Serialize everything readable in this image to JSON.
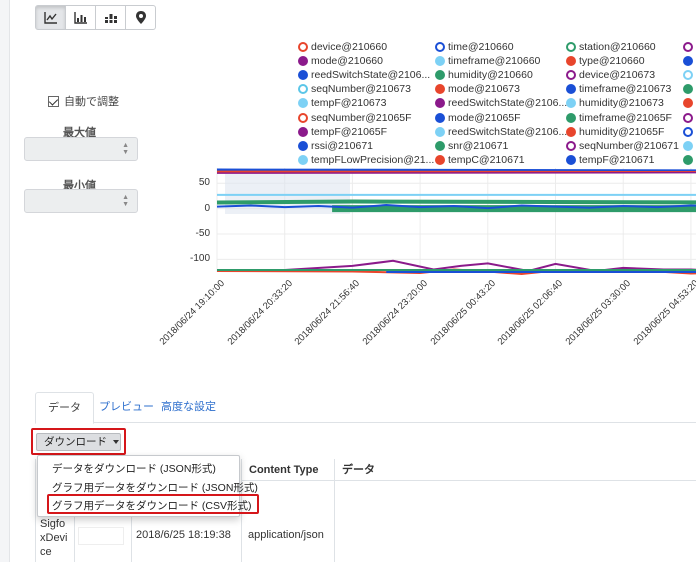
{
  "toolbar": {
    "buttons": [
      {
        "name": "line-chart-icon",
        "active": true
      },
      {
        "name": "bar-chart-icon",
        "active": false
      },
      {
        "name": "stacked-bar-icon",
        "active": false
      },
      {
        "name": "map-pin-icon",
        "active": false
      }
    ]
  },
  "controls": {
    "auto_adjust": "自動で調整",
    "auto_adjust_checked": true,
    "max_label": "最大値",
    "min_label": "最小値",
    "spin_up": "▲",
    "spin_down": "▼"
  },
  "legend": [
    [
      {
        "t": "device@210660",
        "c": "#e8452c",
        "o": true
      },
      {
        "t": "mode@210660",
        "c": "#8b1a8b",
        "o": false
      },
      {
        "t": "reedSwitchState@2106...",
        "c": "#1a4fd6",
        "o": false
      },
      {
        "t": "seqNumber@210673",
        "c": "#5bc6e8",
        "o": true
      },
      {
        "t": "tempF@210673",
        "c": "#7dd1f5",
        "o": false
      },
      {
        "t": "seqNumber@21065F",
        "c": "#e8452c",
        "o": true
      },
      {
        "t": "tempF@21065F",
        "c": "#8b1a8b",
        "o": false
      },
      {
        "t": "rssi@210671",
        "c": "#1a4fd6",
        "o": false
      },
      {
        "t": "tempFLowPrecision@21...",
        "c": "#7dd1f5",
        "o": false
      }
    ],
    [
      {
        "t": "time@210660",
        "c": "#1a4fd6",
        "o": true
      },
      {
        "t": "timeframe@210660",
        "c": "#7dd1f5",
        "o": false
      },
      {
        "t": "humidity@210660",
        "c": "#2e9b6a",
        "o": false
      },
      {
        "t": "mode@210673",
        "c": "#e8452c",
        "o": false
      },
      {
        "t": "reedSwitchState@2106...",
        "c": "#8b1a8b",
        "o": false
      },
      {
        "t": "mode@21065F",
        "c": "#1a4fd6",
        "o": false
      },
      {
        "t": "reedSwitchState@2106...",
        "c": "#7dd1f5",
        "o": false
      },
      {
        "t": "snr@210671",
        "c": "#2e9b6a",
        "o": false
      },
      {
        "t": "tempC@210671",
        "c": "#e8452c",
        "o": false
      }
    ],
    [
      {
        "t": "station@210660",
        "c": "#2e9b6a",
        "o": true
      },
      {
        "t": "type@210660",
        "c": "#e8452c",
        "o": false
      },
      {
        "t": "device@210673",
        "c": "#8b1a8b",
        "o": true
      },
      {
        "t": "timeframe@210673",
        "c": "#1a4fd6",
        "o": false
      },
      {
        "t": "humidity@210673",
        "c": "#7dd1f5",
        "o": false
      },
      {
        "t": "timeframe@21065F",
        "c": "#2e9b6a",
        "o": false
      },
      {
        "t": "humidity@21065F",
        "c": "#e8452c",
        "o": false
      },
      {
        "t": "seqNumber@210671",
        "c": "#8b1a8b",
        "o": true
      },
      {
        "t": "tempF@210671",
        "c": "#1a4fd6",
        "o": false
      }
    ],
    [
      {
        "t": "",
        "c": "#8b1a8b",
        "o": true
      },
      {
        "t": "",
        "c": "#1a4fd6",
        "o": false
      },
      {
        "t": "",
        "c": "#7dd1f5",
        "o": true
      },
      {
        "t": "",
        "c": "#2e9b6a",
        "o": false
      },
      {
        "t": "",
        "c": "#e8452c",
        "o": false
      },
      {
        "t": "",
        "c": "#8b1a8b",
        "o": true
      },
      {
        "t": "",
        "c": "#1a4fd6",
        "o": true
      },
      {
        "t": "",
        "c": "#7dd1f5",
        "o": false
      },
      {
        "t": "",
        "c": "#2e9b6a",
        "o": false
      }
    ]
  ],
  "chart_data": {
    "type": "line",
    "y_ticks": [
      "50",
      "0",
      "-50",
      "-100"
    ],
    "y_tick_values": [
      50,
      0,
      -50,
      -100
    ],
    "ylim": [
      -125,
      80
    ],
    "x_ticks": [
      "2018/06/24 19:10:00",
      "2018/06/24 20:33:20",
      "2018/06/24 21:56:40",
      "2018/06/24 23:20:00",
      "2018/06/25 00:43:20",
      "2018/06/25 02:06:40",
      "2018/06/25 03:30:00",
      "2018/06/25 04:53:20"
    ],
    "series": [
      {
        "color": "#2e9b6a",
        "width": 4,
        "x": [
          0,
          2,
          8
        ],
        "y": [
          12,
          14,
          12
        ]
      },
      {
        "color": "#1a4fd6",
        "width": 3,
        "x": [
          0,
          8
        ],
        "y": [
          76,
          74
        ]
      },
      {
        "color": "#e8452c",
        "width": 2,
        "x": [
          0,
          8
        ],
        "y": [
          73,
          72
        ]
      },
      {
        "color": "#8b1a8b",
        "width": 1.5,
        "x": [
          0,
          8
        ],
        "y": [
          70,
          71
        ]
      },
      {
        "color": "#2e9b6a",
        "width": 7,
        "x": [
          1.7,
          8
        ],
        "y": [
          0,
          0
        ]
      },
      {
        "color": "#7dd1f5",
        "width": 2,
        "x": [
          0,
          8
        ],
        "y": [
          27,
          27
        ]
      },
      {
        "color": "#1a4fd6",
        "width": 2,
        "x": [
          0,
          0.5,
          1,
          1.5,
          2,
          2.5,
          3,
          3.5,
          4,
          4.5,
          5,
          5.5,
          6,
          6.5,
          7,
          7.5,
          8
        ],
        "y": [
          4,
          6,
          3,
          5,
          2,
          7,
          3,
          5,
          1,
          6,
          4,
          2,
          5,
          3,
          6,
          4,
          5
        ]
      },
      {
        "color": "#8b1a8b",
        "width": 2,
        "x": [
          0,
          1,
          2,
          2.6,
          3.2,
          3.6,
          4,
          4.6,
          5,
          5.6,
          6,
          6.6,
          7,
          7.5,
          8
        ],
        "y": [
          -123,
          -121,
          -113,
          -103,
          -120,
          -113,
          -108,
          -123,
          -109,
          -123,
          -117,
          -120,
          -120,
          -123,
          -126
        ]
      },
      {
        "color": "#e8452c",
        "width": 2,
        "x": [
          0,
          2,
          3,
          3.5,
          4,
          4.5,
          5,
          5.5,
          6,
          6.5,
          7,
          7.5,
          8
        ],
        "y": [
          -123,
          -124,
          -127,
          -120,
          -124,
          -129,
          -122,
          -121,
          -125,
          -124,
          -128,
          -126,
          -127
        ]
      },
      {
        "color": "#1a4fd6",
        "width": 2,
        "x": [
          2.5,
          8
        ],
        "y": [
          -125,
          -125
        ]
      },
      {
        "color": "#2e9b6a",
        "width": 2,
        "x": [
          0,
          8
        ],
        "y": [
          -121,
          -121
        ]
      }
    ]
  },
  "tabs": [
    {
      "label": "データ",
      "active": true
    },
    {
      "label": "プレビュー",
      "active": false
    },
    {
      "label": "高度な設定",
      "active": false
    }
  ],
  "download": {
    "label": "ダウンロード"
  },
  "menu": {
    "items": [
      "データをダウンロード (JSON形式)",
      "グラフ用データをダウンロード (JSON形式)",
      "グラフ用データをダウンロード (CSV形式)"
    ]
  },
  "table": {
    "headers": [
      "Content Type",
      "データ"
    ],
    "row": {
      "device": "Sigfo\nxDevi\nce",
      "timestamp": "2018/6/25 18:19:38",
      "content_type": "application/json"
    }
  }
}
